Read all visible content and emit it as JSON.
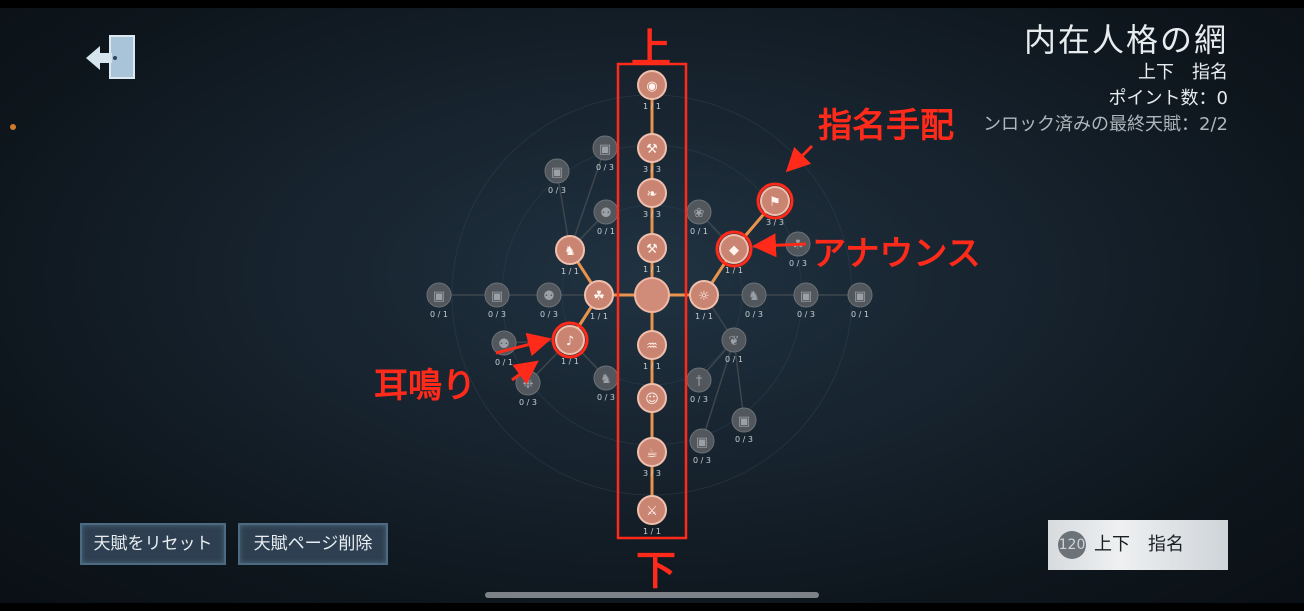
{
  "header": {
    "title": "内在人格の網",
    "page_name": "上下　指名",
    "points": "ポイント数：0",
    "unlocked": "ンロック済みの最終天賦：2/2"
  },
  "buttons": {
    "reset": "天賦をリセット",
    "delete_page": "天賦ページ削除"
  },
  "page_card": {
    "number": "120",
    "name": "上下　指名"
  },
  "annotations": {
    "up": "上",
    "down": "下",
    "shimei": "指名手配",
    "announce": "アナウンス",
    "mimi": "耳鳴り"
  },
  "colors": {
    "accent": "#ff2a1a",
    "node_active": "#c98472",
    "node_inactive": "#51575d",
    "link_active": "#e8944e"
  },
  "talents": {
    "up": [
      {
        "icon": "eye-rune-icon",
        "count": "1 / 1",
        "active": true
      },
      {
        "icon": "hammer-icon",
        "count": "3 / 3",
        "active": true
      },
      {
        "icon": "whip-icon",
        "count": "3 / 3",
        "active": true
      },
      {
        "icon": "wrench-icon",
        "count": "1 / 1",
        "active": true
      }
    ],
    "down": [
      {
        "icon": "fish-icon",
        "count": "1 / 1",
        "active": true
      },
      {
        "icon": "grin-icon",
        "count": "",
        "active": true
      },
      {
        "icon": "cup-icon",
        "count": "3 / 3",
        "active": true
      },
      {
        "icon": "axe-icon",
        "count": "1 / 1",
        "active": true
      }
    ],
    "left": [
      {
        "icon": "deer-skull-icon",
        "count": "1 / 1",
        "active": true
      },
      {
        "icon": "monkey-icon",
        "count": "0 / 3",
        "active": false
      },
      {
        "icon": "lock-icon",
        "count": "0 / 3",
        "active": false
      },
      {
        "icon": "lock-icon",
        "count": "0 / 1",
        "active": false
      }
    ],
    "right": [
      {
        "icon": "owl-icon",
        "count": "1 / 1",
        "active": true
      },
      {
        "icon": "horse-icon",
        "count": "0 / 3",
        "active": false
      },
      {
        "icon": "lock-icon",
        "count": "0 / 3",
        "active": false
      },
      {
        "icon": "lock-icon",
        "count": "0 / 1",
        "active": false
      }
    ],
    "up_left": [
      {
        "icon": "beast-icon",
        "count": "1 / 1",
        "active": true
      },
      {
        "icon": "creature-icon",
        "count": "0 / 1",
        "active": false
      },
      {
        "icon": "lock-icon",
        "count": "0 / 3",
        "active": false
      },
      {
        "icon": "lock-icon",
        "count": "0 / 3",
        "active": false
      }
    ],
    "up_right": [
      {
        "icon": "announce-icon",
        "count": "1 / 1",
        "active": true
      },
      {
        "icon": "wanted-icon",
        "count": "3 / 3",
        "active": true
      },
      {
        "icon": "squirrel-icon",
        "count": "0 / 3",
        "active": false
      },
      {
        "icon": "parrot-icon",
        "count": "0 / 1",
        "active": false
      }
    ],
    "down_left": [
      {
        "icon": "tinnitus-icon",
        "count": "1 / 1",
        "active": true
      },
      {
        "icon": "horse-head-icon",
        "count": "0 / 3",
        "active": false
      },
      {
        "icon": "cat-icon",
        "count": "0 / 3",
        "active": false
      },
      {
        "icon": "shoe-icon",
        "count": "0 / 1",
        "active": false
      }
    ],
    "down_right": [
      {
        "icon": "bat-icon",
        "count": "0 / 1",
        "active": false
      },
      {
        "icon": "knife-icon",
        "count": "0 / 3",
        "active": false
      },
      {
        "icon": "lock-icon",
        "count": "0 / 3",
        "active": false
      },
      {
        "icon": "lock-icon",
        "count": "0 / 3",
        "active": false
      }
    ]
  }
}
